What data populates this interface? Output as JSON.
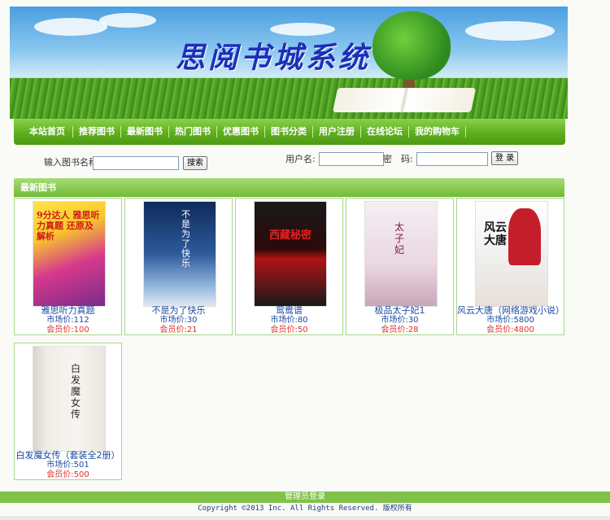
{
  "banner": {
    "title": "思阅书城系统"
  },
  "nav": {
    "items": [
      "本站首页",
      "推荐图书",
      "最新图书",
      "热门图书",
      "优惠图书",
      "图书分类",
      "用户注册",
      "在线论坛",
      "我的购物车"
    ]
  },
  "search": {
    "label": "输入图书名称",
    "value": "",
    "button": "搜索"
  },
  "login": {
    "username_label": "用户名:",
    "username_value": "",
    "password_label": "密　码:",
    "password_value": "",
    "button": "登 录"
  },
  "section": {
    "title": "最新图书"
  },
  "books": [
    {
      "name": "雅思听力真题",
      "market": "市场价:112",
      "member": "会员价:100",
      "cover_text": "9分达人 雅思听力真题 还原及解析"
    },
    {
      "name": "不是为了快乐",
      "market": "市场价:30",
      "member": "会员价:21",
      "cover_text": "不是为了快乐"
    },
    {
      "name": "鸳鸯谱",
      "market": "市场价:80",
      "member": "会员价:50",
      "cover_text": "西藏秘密"
    },
    {
      "name": "极品太子妃1",
      "market": "市场价:30",
      "member": "会员价:28",
      "cover_text": "太子妃"
    },
    {
      "name": "风云大唐（网络游戏小说）",
      "market": "市场价:5800",
      "member": "会员价:4800",
      "cover_text": "风云大唐"
    },
    {
      "name": "白发魔女传（套装全2册）",
      "market": "市场价:501",
      "member": "会员价:500",
      "cover_text": "白发魔女传"
    }
  ],
  "footer": {
    "admin_link": "管理员登录",
    "copyright": "Copyright ©2013 Inc. All Rights Reserved. 版权所有"
  },
  "colors": {
    "nav_green": "#5fae1f",
    "section_green": "#72bb36",
    "price_blue": "#1b4aa0",
    "price_red": "#e03030"
  }
}
